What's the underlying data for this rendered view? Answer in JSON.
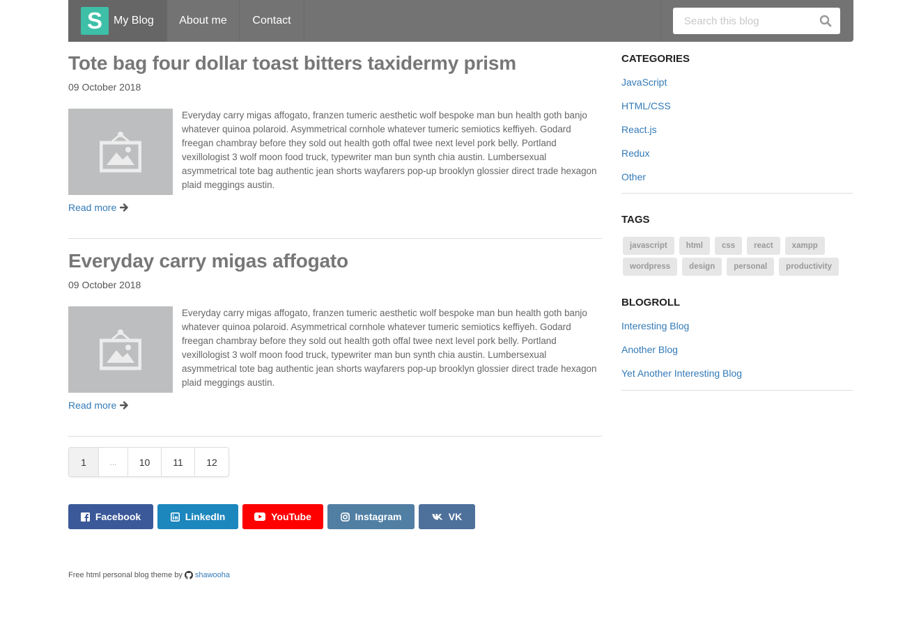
{
  "navbar": {
    "brand_letter": "S",
    "brand_label": "My Blog",
    "links": [
      "About me",
      "Contact"
    ],
    "search_placeholder": "Search this blog"
  },
  "posts": [
    {
      "title": "Tote bag four dollar toast bitters taxidermy prism",
      "date": "09 October 2018",
      "excerpt": "Everyday carry migas affogato, franzen tumeric aesthetic wolf bespoke man bun health goth banjo whatever quinoa polaroid. Asymmetrical cornhole whatever tumeric semiotics keffiyeh. Godard freegan chambray before they sold out health goth offal twee next level pork belly. Portland vexillologist 3 wolf moon food truck, typewriter man bun synth chia austin. Lumbersexual asymmetrical tote bag authentic jean shorts wayfarers pop-up brooklyn glossier direct trade hexagon plaid meggings austin.",
      "read_more": "Read more"
    },
    {
      "title": "Everyday carry migas affogato",
      "date": "09 October 2018",
      "excerpt": "Everyday carry migas affogato, franzen tumeric aesthetic wolf bespoke man bun health goth banjo whatever quinoa polaroid. Asymmetrical cornhole whatever tumeric semiotics keffiyeh. Godard freegan chambray before they sold out health goth offal twee next level pork belly. Portland vexillologist 3 wolf moon food truck, typewriter man bun synth chia austin. Lumbersexual asymmetrical tote bag authentic jean shorts wayfarers pop-up brooklyn glossier direct trade hexagon plaid meggings austin.",
      "read_more": "Read more"
    }
  ],
  "pagination": [
    "1",
    "...",
    "10",
    "11",
    "12"
  ],
  "social": [
    {
      "label": "Facebook",
      "icon": "facebook-icon",
      "color": "#3b5998"
    },
    {
      "label": "LinkedIn",
      "icon": "linkedin-icon",
      "color": "#1c87bd"
    },
    {
      "label": "YouTube",
      "icon": "youtube-icon",
      "color": "#ff0000"
    },
    {
      "label": "Instagram",
      "icon": "instagram-icon",
      "color": "#517fa4"
    },
    {
      "label": "VK",
      "icon": "vk-icon",
      "color": "#4e719b"
    }
  ],
  "footer": {
    "text": "Free html personal blog theme by",
    "author": "shawooha"
  },
  "sidebar": {
    "categories_title": "CATEGORIES",
    "categories": [
      "JavaScript",
      "HTML/CSS",
      "React.js",
      "Redux",
      "Other"
    ],
    "tags_title": "TAGS",
    "tags": [
      "javascript",
      "html",
      "css",
      "react",
      "xampp",
      "wordpress",
      "design",
      "personal",
      "productivity"
    ],
    "blogroll_title": "BLOGROLL",
    "blogroll": [
      "Interesting Blog",
      "Another Blog",
      "Yet Another Interesting Blog"
    ]
  },
  "colors": {
    "navbar": "#737373",
    "brand_accent": "#3dbfa8",
    "link": "#337ab7"
  }
}
